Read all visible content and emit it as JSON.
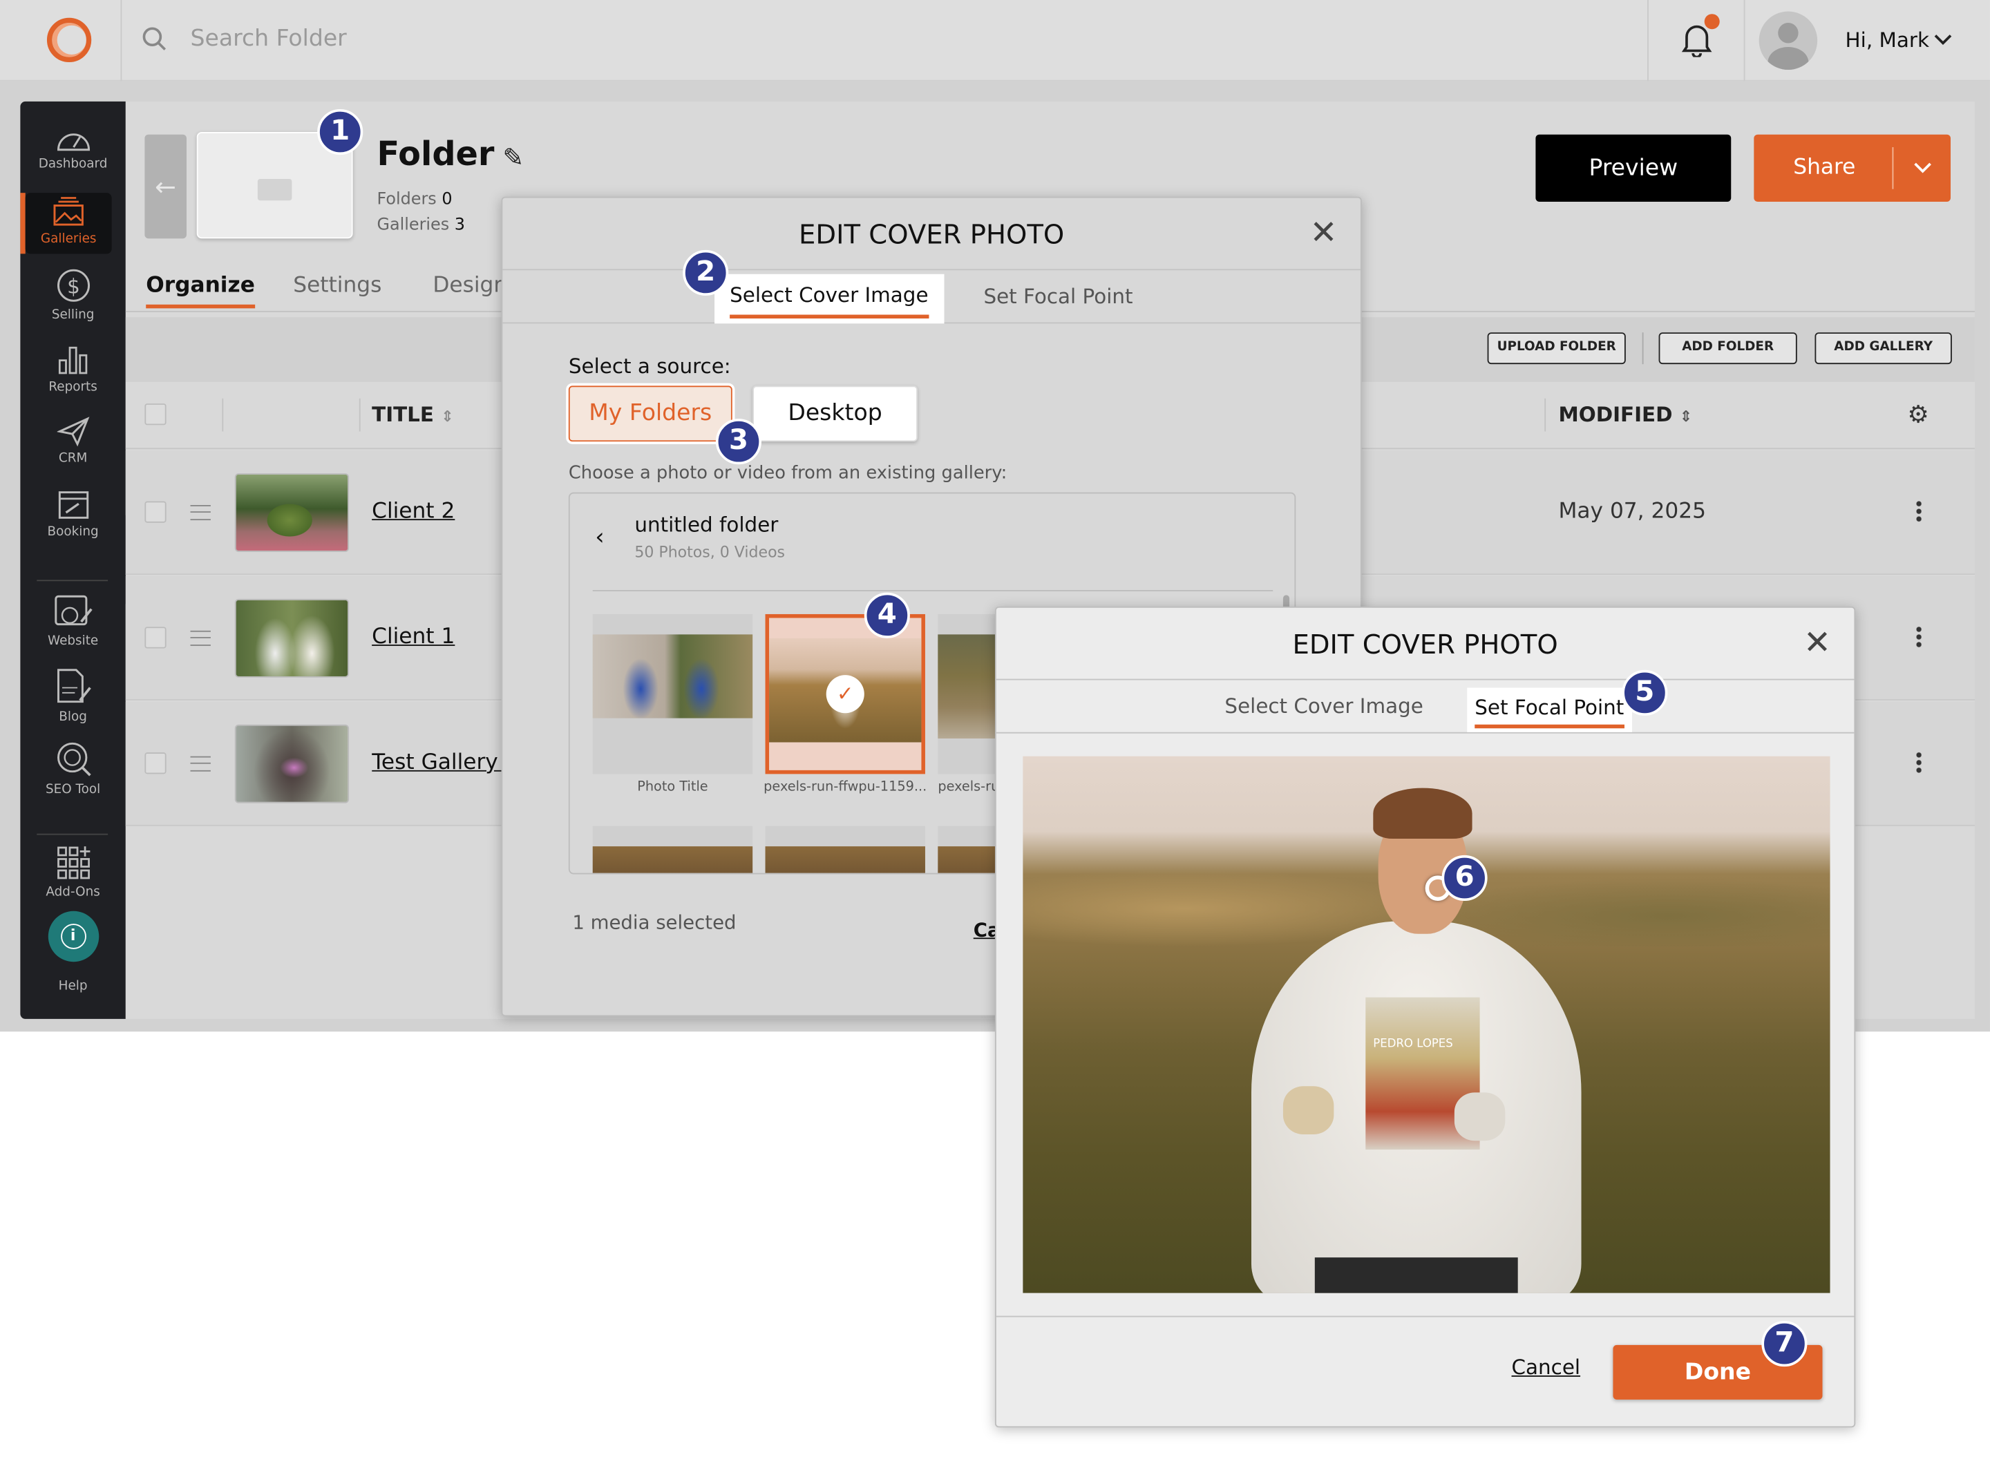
{
  "topbar": {
    "search_placeholder": "Search Folder",
    "greeting": "Hi, Mark",
    "notification_dot_color": "#e0622a"
  },
  "sidebar": {
    "items": [
      {
        "label": "Dashboard"
      },
      {
        "label": "Galleries",
        "active": true
      },
      {
        "label": "Selling"
      },
      {
        "label": "Reports"
      },
      {
        "label": "CRM"
      },
      {
        "label": "Booking"
      },
      {
        "label": "Website"
      },
      {
        "label": "Blog"
      },
      {
        "label": "SEO Tool"
      },
      {
        "label": "Add-Ons"
      },
      {
        "label": "Help"
      }
    ]
  },
  "header": {
    "title": "Folder",
    "folders_label": "Folders",
    "folders_count": "0",
    "galleries_label": "Galleries",
    "galleries_count": "3",
    "preview": "Preview",
    "share": "Share"
  },
  "tabs": [
    {
      "label": "Organize",
      "active": true
    },
    {
      "label": "Settings"
    },
    {
      "label": "Design"
    }
  ],
  "actions": {
    "upload_folder": "UPLOAD FOLDER",
    "add_folder": "ADD FOLDER",
    "add_gallery": "ADD GALLERY"
  },
  "table": {
    "col_title": "TITLE",
    "col_modified": "MODIFIED",
    "rows": [
      {
        "title": "Client 2",
        "modified": "May 07, 2025"
      },
      {
        "title": "Client 1",
        "modified": ""
      },
      {
        "title": "Test Gallery 1",
        "modified": ""
      }
    ]
  },
  "modal1": {
    "title": "EDIT COVER PHOTO",
    "tab_select": "Select Cover Image",
    "tab_focal": "Set Focal Point",
    "source_label": "Select a source:",
    "my_folders": "My Folders",
    "desktop": "Desktop",
    "choose_label": "Choose a photo or video from an existing gallery:",
    "folder_name": "untitled folder",
    "folder_meta": "50 Photos, 0 Videos",
    "photos": [
      {
        "caption": "Photo Title"
      },
      {
        "caption": "pexels-run-ffwpu-1159...",
        "selected": true
      },
      {
        "caption": "pexels-run"
      }
    ],
    "media_selected": "1 media selected",
    "cancel": "Cancel"
  },
  "modal2": {
    "title": "EDIT COVER PHOTO",
    "tab_select": "Select Cover Image",
    "tab_focal": "Set Focal Point",
    "bib_text": "PEDRO LOPES",
    "cancel": "Cancel",
    "done": "Done"
  },
  "badges": [
    "1",
    "2",
    "3",
    "4",
    "5",
    "6",
    "7"
  ],
  "colors": {
    "accent": "#e0622a",
    "badge": "#2f3b8f",
    "sidebar": "#1f2024"
  }
}
